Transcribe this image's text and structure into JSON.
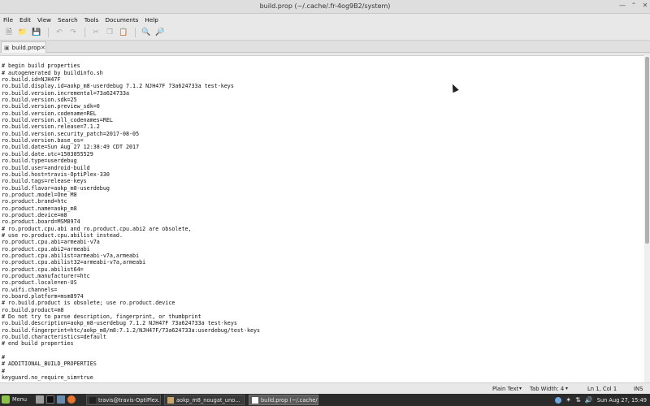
{
  "window": {
    "title": "build.prop (~/.cache/.fr-4og9B2/system)"
  },
  "menubar": [
    "File",
    "Edit",
    "View",
    "Search",
    "Tools",
    "Documents",
    "Help"
  ],
  "toolbar": [
    "new-document-icon",
    "open-icon",
    "save-icon",
    "undo-icon",
    "redo-icon",
    "cut-icon",
    "copy-icon",
    "paste-icon",
    "find-icon",
    "find-replace-icon"
  ],
  "tab": {
    "label": "build.prop"
  },
  "editor": {
    "lines": [
      "",
      "# begin build properties",
      "# autogenerated by buildinfo.sh",
      "ro.build.id=NJH47F",
      "ro.build.display.id=aokp_m8-userdebug 7.1.2 NJH47F 73a624733a test-keys",
      "ro.build.version.incremental=73a624733a",
      "ro.build.version.sdk=25",
      "ro.build.version.preview_sdk=0",
      "ro.build.version.codename=REL",
      "ro.build.version.all_codenames=REL",
      "ro.build.version.release=7.1.2",
      "ro.build.version.security_patch=2017-08-05",
      "ro.build.version.base_os=",
      "ro.build.date=Sun Aug 27 12:38:49 CDT 2017",
      "ro.build.date.utc=1503855529",
      "ro.build.type=userdebug",
      "ro.build.user=android-build",
      "ro.build.host=travis-OptiPlex-330",
      "ro.build.tags=release-keys",
      "ro.build.flavor=aokp_m8-userdebug",
      "ro.product.model=One M8",
      "ro.product.brand=htc",
      "ro.product.name=aokp_m8",
      "ro.product.device=m8",
      "ro.product.board=MSM8974",
      "# ro.product.cpu.abi and ro.product.cpu.abi2 are obsolete,",
      "# use ro.product.cpu.abilist instead.",
      "ro.product.cpu.abi=armeabi-v7a",
      "ro.product.cpu.abi2=armeabi",
      "ro.product.cpu.abilist=armeabi-v7a,armeabi",
      "ro.product.cpu.abilist32=armeabi-v7a,armeabi",
      "ro.product.cpu.abilist64=",
      "ro.product.manufacturer=htc",
      "ro.product.locale=en-US",
      "ro.wifi.channels=",
      "ro.board.platform=msm8974",
      "# ro.build.product is obsolete; use ro.product.device",
      "ro.build.product=m8",
      "# Do not try to parse description, fingerprint, or thumbprint",
      "ro.build.description=aokp_m8-userdebug 7.1.2 NJH47F 73a624733a test-keys",
      "ro.build.fingerprint=htc/aokp_m8/m8:7.1.2/NJH47F/73a624733a:userdebug/test-keys",
      "ro.build.characteristics=default",
      "# end build properties",
      "",
      "#",
      "# ADDITIONAL_BUILD_PROPERTIES",
      "#",
      "keyguard.no_require_sim=true"
    ]
  },
  "statusbar": {
    "syntax": "Plain Text",
    "tab_width": "Tab Width: 4",
    "position": "Ln 1, Col 1",
    "mode": "INS"
  },
  "taskbar": {
    "menu_label": "Menu",
    "tasks": [
      {
        "label": "travis@travis-OptiPlex...",
        "icon_color": "#222222",
        "active": false
      },
      {
        "label": "aokp_m8_nougat_uno...",
        "icon_color": "#c9a66b",
        "active": false
      },
      {
        "label": "build.prop (~/.cache/.f...",
        "icon_color": "#ffffff",
        "active": true
      }
    ],
    "clock": "Sun Aug 27, 15:49"
  }
}
